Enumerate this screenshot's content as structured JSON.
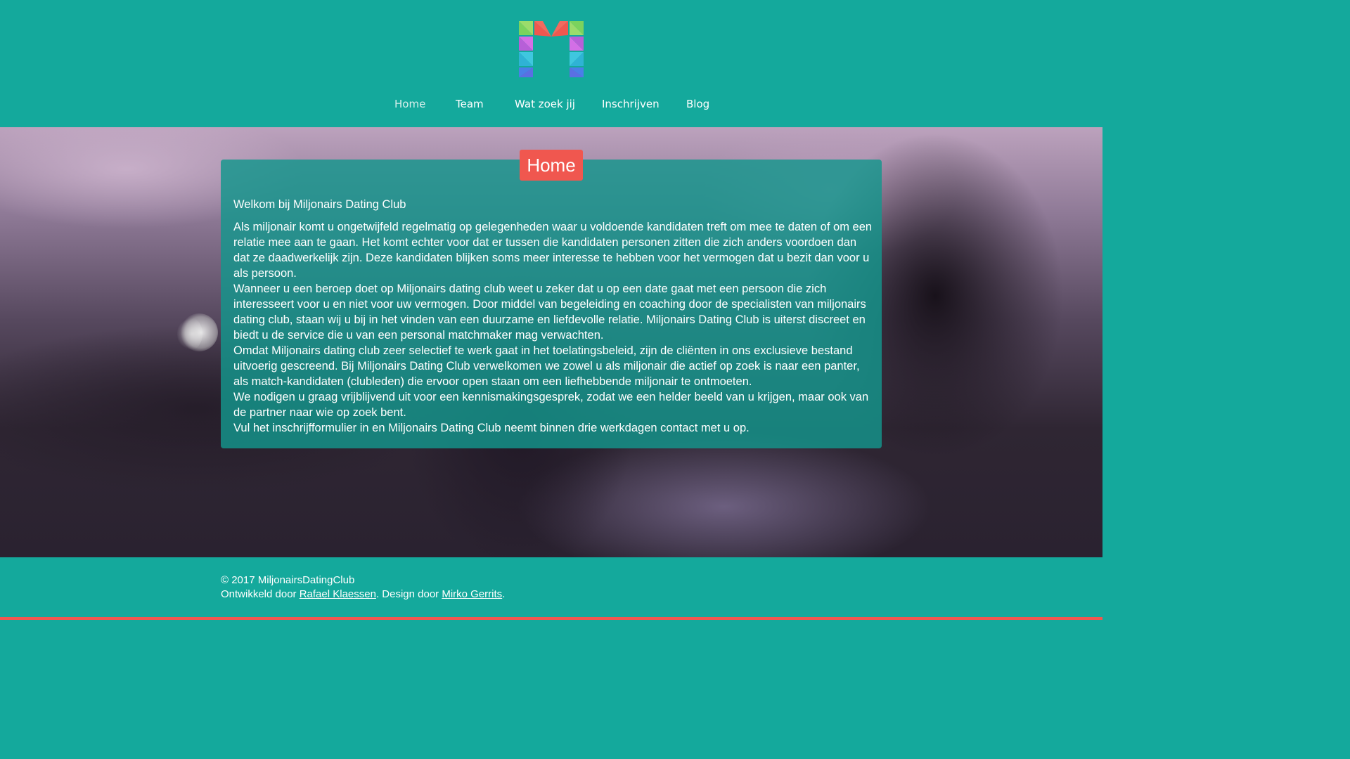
{
  "brand": {
    "logo_icon": "m-logo-icon",
    "colors": {
      "teal": "#14a99c",
      "coral": "#f0574f"
    }
  },
  "nav": {
    "items": [
      {
        "label": "Home",
        "active": true
      },
      {
        "label": "Team",
        "active": false
      },
      {
        "label": "Wat zoek jij",
        "active": false
      },
      {
        "label": "Inschrijven",
        "active": false
      },
      {
        "label": "Blog",
        "active": false
      }
    ]
  },
  "main": {
    "title": "Home",
    "heading": "Welkom bij Miljonairs Dating Club",
    "paragraphs": [
      "Als miljonair komt u ongetwijfeld regelmatig op gelegenheden waar u voldoende kandidaten treft om mee te daten of om een relatie mee aan te gaan. Het komt echter voor dat er tussen die kandidaten personen zitten die zich anders voordoen dan dat ze daadwerkelijk zijn. Deze kandidaten blijken soms meer interesse te hebben voor het vermogen dat u bezit dan voor u als persoon.",
      "Wanneer u een beroep doet op Miljonairs dating club weet u zeker dat u op een date gaat met een persoon die zich interesseert voor u en niet voor uw vermogen. Door middel van begeleiding en coaching door de specialisten van miljonairs dating club, staan wij u bij in het vinden van een duurzame en liefdevolle relatie. Miljonairs Dating Club is uiterst discreet en biedt u de service die u van een personal matchmaker mag verwachten.",
      "Omdat Miljonairs dating club zeer selectief te werk gaat in het toelatingsbeleid, zijn de cliënten in ons exclusieve bestand uitvoerig gescreend. Bij Miljonairs Dating Club verwelkomen we zowel u als miljonair die actief op zoek is naar een panter, als match-kandidaten (clubleden) die ervoor open staan om een liefhebbende miljonair te ontmoeten.",
      "We nodigen u graag vrijblijvend uit voor een kennismakingsgesprek, zodat we een helder beeld van u krijgen, maar ook van de partner naar wie op zoek bent.",
      "Vul het inschrijfformulier in en Miljonairs Dating Club neemt binnen drie werkdagen contact met u op."
    ]
  },
  "footer": {
    "copyright": "© 2017 MiljonairsDatingClub",
    "developed_prefix": "Ontwikkeld door ",
    "developer": "Rafael Klaessen",
    "design_prefix": ". Design door ",
    "designer": "Mirko Gerrits",
    "suffix": "."
  }
}
